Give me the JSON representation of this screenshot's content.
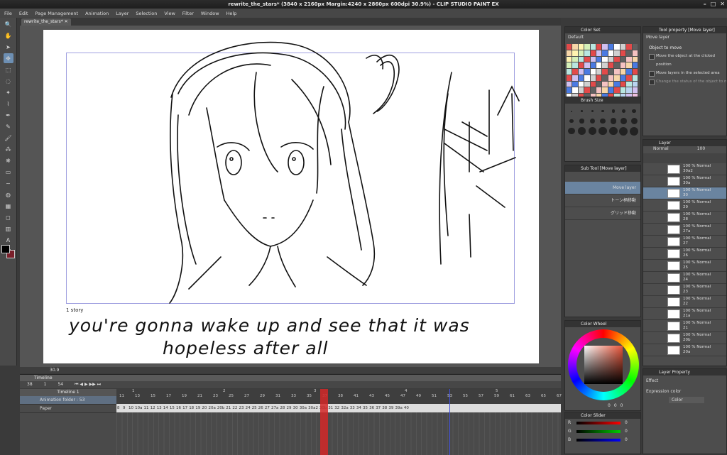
{
  "window": {
    "title": "rewrite_the_stars* (3840 x 2160px Margin:4240 x 2860px 600dpi 30.9%) - CLIP STUDIO PAINT EX"
  },
  "menu": [
    "File",
    "Edit",
    "Page Management",
    "Animation",
    "Layer",
    "Selection",
    "View",
    "Filter",
    "Window",
    "Help"
  ],
  "document_tab": "rewrite_the_stars*",
  "canvas": {
    "story_label": "1 story",
    "line1": "you're gonna wake up and see that it was",
    "line2": "hopeless after all",
    "zoom": "30.9"
  },
  "timeline": {
    "panel_title": "Timeline",
    "current_frame": "38",
    "start_frame": "1",
    "end_frame": "54",
    "track_name": "Timeline 1",
    "tracks": [
      "Animation folder : 53",
      "Paper"
    ],
    "ruler_marks": [
      "1",
      "2",
      "3",
      "4",
      "5"
    ],
    "ruler_nums": [
      "11",
      "13",
      "15",
      "17",
      "19",
      "21",
      "23",
      "25",
      "27",
      "29",
      "31",
      "33",
      "35",
      "37",
      "38",
      "41",
      "43",
      "45",
      "47",
      "49",
      "51",
      "53",
      "55",
      "57",
      "59",
      "61",
      "63",
      "65",
      "67"
    ],
    "cells": [
      "8",
      "9",
      "10",
      "10a",
      "11",
      "12",
      "13",
      "14",
      "15",
      "16",
      "17",
      "18",
      "19",
      "20",
      "20a",
      "20b",
      "21",
      "22",
      "23",
      "24",
      "25",
      "26",
      "27",
      "27a",
      "28",
      "29",
      "30",
      "30a",
      "30a2",
      "30b",
      "31",
      "32",
      "32a",
      "33",
      "34",
      "35",
      "36",
      "37",
      "38",
      "39",
      "39a",
      "40"
    ]
  },
  "color_set": {
    "title": "Color Set",
    "selected": "Default"
  },
  "brush_size": {
    "title": "Brush Size",
    "sizes": [
      "1",
      "2",
      "3",
      "4",
      "5",
      "6",
      "7",
      "8",
      "10",
      "12",
      "15",
      "17",
      "20",
      "25",
      "30",
      "40",
      "50",
      "60",
      "70",
      "80",
      "100"
    ]
  },
  "sub_tool": {
    "title": "Sub Tool [Move layer]",
    "items": [
      "Move layer",
      "トーン柄移動",
      "グリッド移動"
    ]
  },
  "tool_property": {
    "title": "Tool property [Move layer]",
    "heading": "Move layer",
    "object_label": "Object to move",
    "options": [
      "Move the object at the clicked position",
      "Move layers in the selected area",
      "Change the status of the object to move to acti"
    ]
  },
  "layer_panel": {
    "title": "Layer",
    "blend": "Normal",
    "opacity": "100",
    "layers": [
      {
        "pct": "100 % Normal",
        "name": "30a2"
      },
      {
        "pct": "100 % Normal",
        "name": "30a"
      },
      {
        "pct": "100 % Normal",
        "name": "30"
      },
      {
        "pct": "100 % Normal",
        "name": "29"
      },
      {
        "pct": "100 % Normal",
        "name": "28"
      },
      {
        "pct": "100 % Normal",
        "name": "27a"
      },
      {
        "pct": "100 % Normal",
        "name": "27"
      },
      {
        "pct": "100 % Normal",
        "name": "26"
      },
      {
        "pct": "100 % Normal",
        "name": "25"
      },
      {
        "pct": "100 % Normal",
        "name": "24"
      },
      {
        "pct": "100 % Normal",
        "name": "23"
      },
      {
        "pct": "100 % Normal",
        "name": "22"
      },
      {
        "pct": "100 % Normal",
        "name": "21a"
      },
      {
        "pct": "100 % Normal",
        "name": "21"
      },
      {
        "pct": "100 % Normal",
        "name": "20b"
      },
      {
        "pct": "100 % Normal",
        "name": "20a"
      }
    ]
  },
  "color_wheel": {
    "title": "Color Wheel",
    "values": [
      "0",
      "0",
      "0"
    ]
  },
  "layer_property": {
    "title": "Layer Property",
    "effect_label": "Effect",
    "expression_label": "Expression color",
    "expression_value": "Color"
  },
  "color_slider": {
    "title": "Color Slider",
    "channels": [
      {
        "label": "R",
        "value": "0"
      },
      {
        "label": "G",
        "value": "0"
      },
      {
        "label": "B",
        "value": "0"
      }
    ]
  },
  "colors": {
    "accent": "#6a84a0",
    "playhead": "#d02828",
    "main": "#000000",
    "sub": "#7a1f2a"
  }
}
